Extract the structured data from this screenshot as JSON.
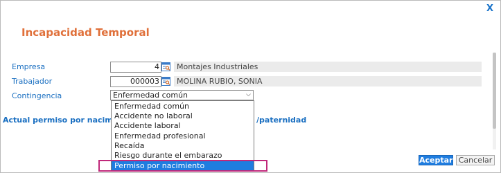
{
  "dialog": {
    "close_label": "X",
    "title": "Incapacidad Temporal"
  },
  "form": {
    "empresa": {
      "label": "Empresa",
      "code": "4",
      "name": "Montajes Industriales"
    },
    "trabajador": {
      "label": "Trabajador",
      "code": "000003",
      "name": "MOLINA RUBIO, SONIA"
    },
    "contingencia": {
      "label": "Contingencia",
      "value": "Enfermedad común"
    }
  },
  "section": {
    "left_text": "Actual permiso por nacimiento",
    "right_text": "/paternidad"
  },
  "dropdown": {
    "options": [
      "Enfermedad común",
      "Accidente no laboral",
      "Accidente laboral",
      "Enfermedad profesional",
      "Recaída",
      "Riesgo durante el embarazo",
      "Permiso por nacimiento"
    ],
    "highlighted": "Permiso por nacimiento"
  },
  "buttons": {
    "accept": "Aceptar",
    "cancel": "Cancelar"
  },
  "colors": {
    "title": "#e0703a",
    "label": "#1a6fc1",
    "selection": "#1f7de0",
    "highlight_box": "#c0287a"
  }
}
